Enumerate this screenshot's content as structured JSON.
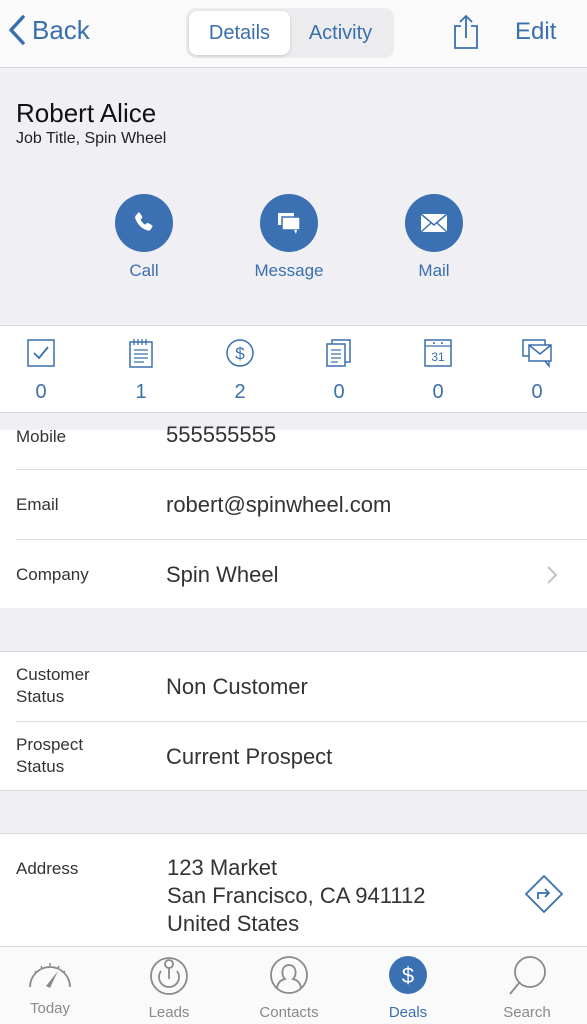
{
  "navbar": {
    "back_label": "Back",
    "tabs": [
      "Details",
      "Activity"
    ],
    "active_tab": "Details",
    "share_icon": "share-icon",
    "edit_label": "Edit"
  },
  "contact": {
    "name": "Robert Alice",
    "subtitle": "Job Title, Spin Wheel"
  },
  "actions": [
    {
      "label": "Call",
      "icon": "phone-icon"
    },
    {
      "label": "Message",
      "icon": "message-icon"
    },
    {
      "label": "Mail",
      "icon": "mail-icon"
    }
  ],
  "counts": [
    {
      "icon": "task-icon",
      "value": "0"
    },
    {
      "icon": "note-icon",
      "value": "1"
    },
    {
      "icon": "deal-icon",
      "value": "2"
    },
    {
      "icon": "document-icon",
      "value": "0"
    },
    {
      "icon": "calendar-icon",
      "value": "0",
      "calendar_day": "31"
    },
    {
      "icon": "email-thread-icon",
      "value": "0"
    }
  ],
  "fields": {
    "mobile": {
      "label": "Mobile",
      "value": "555555555"
    },
    "email": {
      "label": "Email",
      "value": "robert@spinwheel.com"
    },
    "company": {
      "label": "Company",
      "value": "Spin Wheel"
    },
    "customer_status": {
      "label": "Customer Status",
      "value": "Non Customer"
    },
    "prospect_status": {
      "label": "Prospect Status",
      "value": "Current Prospect"
    },
    "address": {
      "label": "Address",
      "line1": "123 Market",
      "line2": "San Francisco, CA 941112",
      "line3": "United States"
    }
  },
  "tabbar": [
    {
      "label": "Today",
      "icon": "speedometer-icon"
    },
    {
      "label": "Leads",
      "icon": "leads-icon"
    },
    {
      "label": "Contacts",
      "icon": "contacts-icon"
    },
    {
      "label": "Deals",
      "icon": "dollar-icon",
      "active": true
    },
    {
      "label": "Search",
      "icon": "search-icon"
    }
  ],
  "colors": {
    "accent": "#3b70b2",
    "background": "#f0eff4",
    "inactive": "#8a8a8e"
  }
}
